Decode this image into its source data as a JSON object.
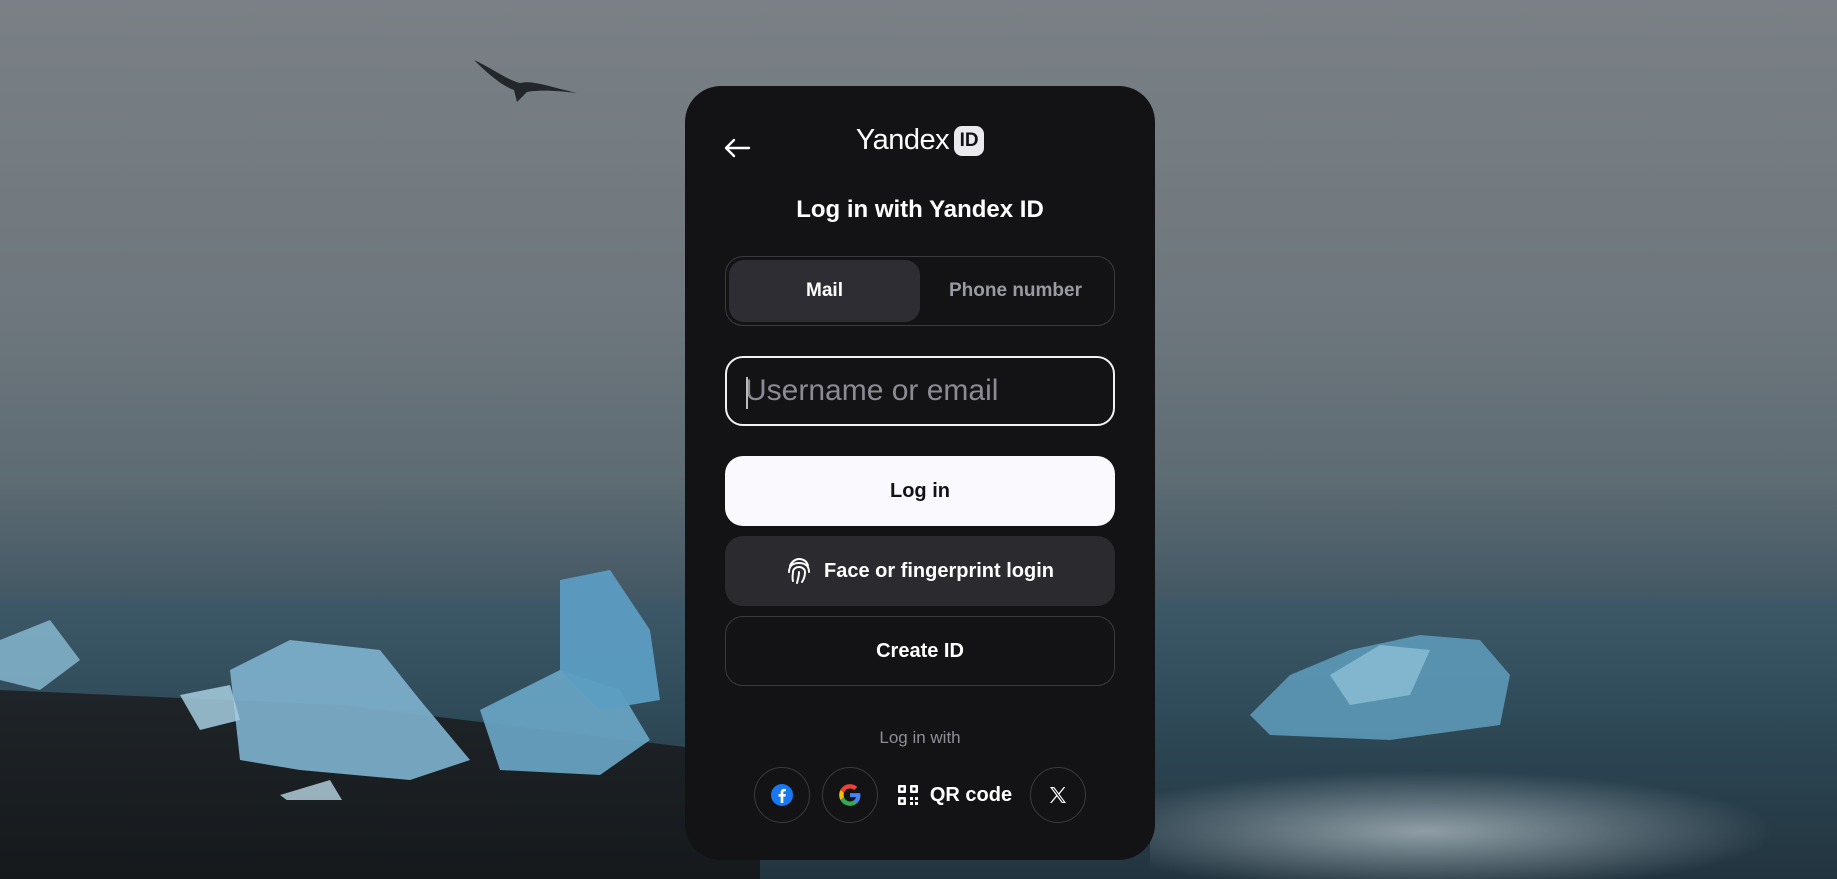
{
  "header": {
    "logo_text": "Yandex",
    "logo_badge": "ID"
  },
  "title": "Log in with Yandex ID",
  "tabs": [
    {
      "label": "Mail",
      "active": true
    },
    {
      "label": "Phone number",
      "active": false
    }
  ],
  "login_field": {
    "placeholder": "Username or email",
    "value": ""
  },
  "buttons": {
    "login": "Log in",
    "face_login": "Face or fingerprint login",
    "create_id": "Create ID"
  },
  "social": {
    "heading": "Log in with",
    "qr_label": "QR code",
    "providers": [
      {
        "name": "facebook",
        "icon": "facebook-icon",
        "color": "#1877F2"
      },
      {
        "name": "google",
        "icon": "google-icon"
      },
      {
        "name": "qr",
        "icon": "qr-code-icon"
      },
      {
        "name": "x",
        "icon": "x-icon"
      }
    ]
  },
  "colors": {
    "card_background": "#131316",
    "primary_button": "#faf9fd",
    "secondary_button": "#2a2a2f"
  }
}
